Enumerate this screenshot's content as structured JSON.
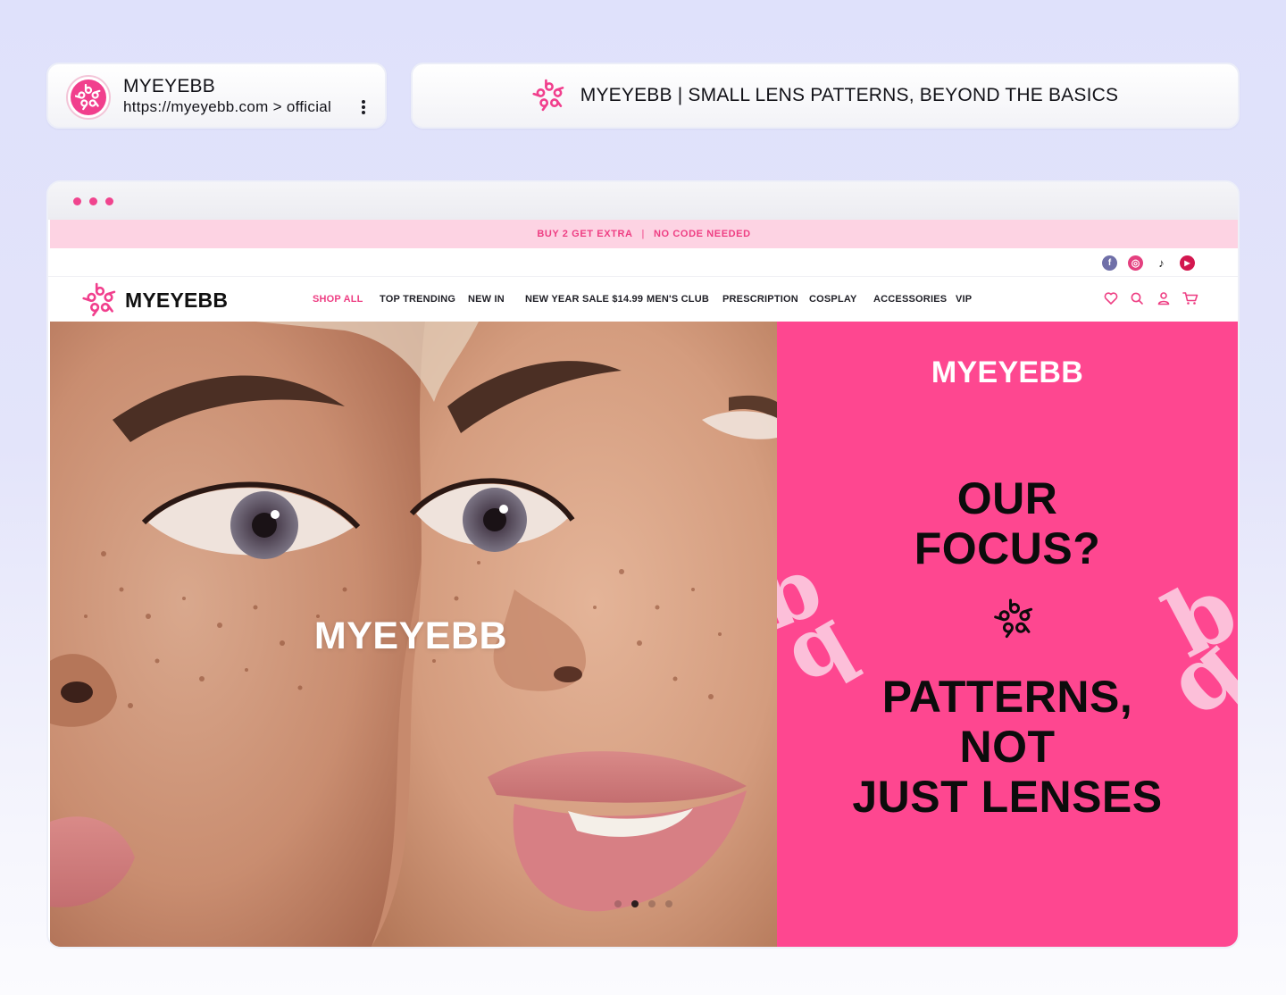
{
  "search_result": {
    "site_name": "MYEYEBB",
    "url": "https://myeyebb.com > official",
    "logo_icon": "myeyebb-logo-icon",
    "menu_icon": "kebab-menu-icon"
  },
  "page_title": {
    "text": "MYEYEBB | SMALL LENS PATTERNS, BEYOND THE BASICS",
    "icon": "myeyebb-logo-icon"
  },
  "browser": {
    "window_dots": [
      "close-dot",
      "minimize-dot",
      "maximize-dot"
    ]
  },
  "promo_bar": {
    "left": "BUY 2 GET EXTRA",
    "separator": "|",
    "right": "NO CODE NEEDED",
    "background": "#fdd3e3",
    "text_color": "#ee3e83"
  },
  "social": [
    {
      "name": "facebook-icon",
      "glyph": "f",
      "color": "#6f6fa8"
    },
    {
      "name": "instagram-icon",
      "glyph": "◎",
      "color": "#e4407f"
    },
    {
      "name": "tiktok-icon",
      "glyph": "♪",
      "color": "#111111"
    },
    {
      "name": "youtube-icon",
      "glyph": "▶",
      "color": "#d3174f"
    }
  ],
  "nav": {
    "brand": "MYEYEBB",
    "items": [
      {
        "label": "SHOP ALL",
        "active": true
      },
      {
        "label": "TOP TRENDING"
      },
      {
        "label": "NEW IN"
      },
      {
        "label": "NEW YEAR SALE $14.99"
      },
      {
        "label": "MEN'S CLUB"
      },
      {
        "label": "PRESCRIPTION"
      },
      {
        "label": "COSPLAY"
      },
      {
        "label": "ACCESSORIES"
      },
      {
        "label": "VIP"
      }
    ],
    "tools": [
      "wishlist-heart-icon",
      "search-icon",
      "account-icon",
      "cart-icon"
    ]
  },
  "hero": {
    "photo_overlay": "MYEYEBB",
    "carousel": {
      "count": 4,
      "active": 2
    },
    "panel_brand": "MYEYEBB",
    "question_line1": "OUR",
    "question_line2": "FOCUS?",
    "answer_line1": "PATTERNS,",
    "answer_line2": "NOT",
    "answer_line3": "JUST LENSES",
    "panel_color": "#fe4790",
    "accent": "#ee3e83"
  }
}
